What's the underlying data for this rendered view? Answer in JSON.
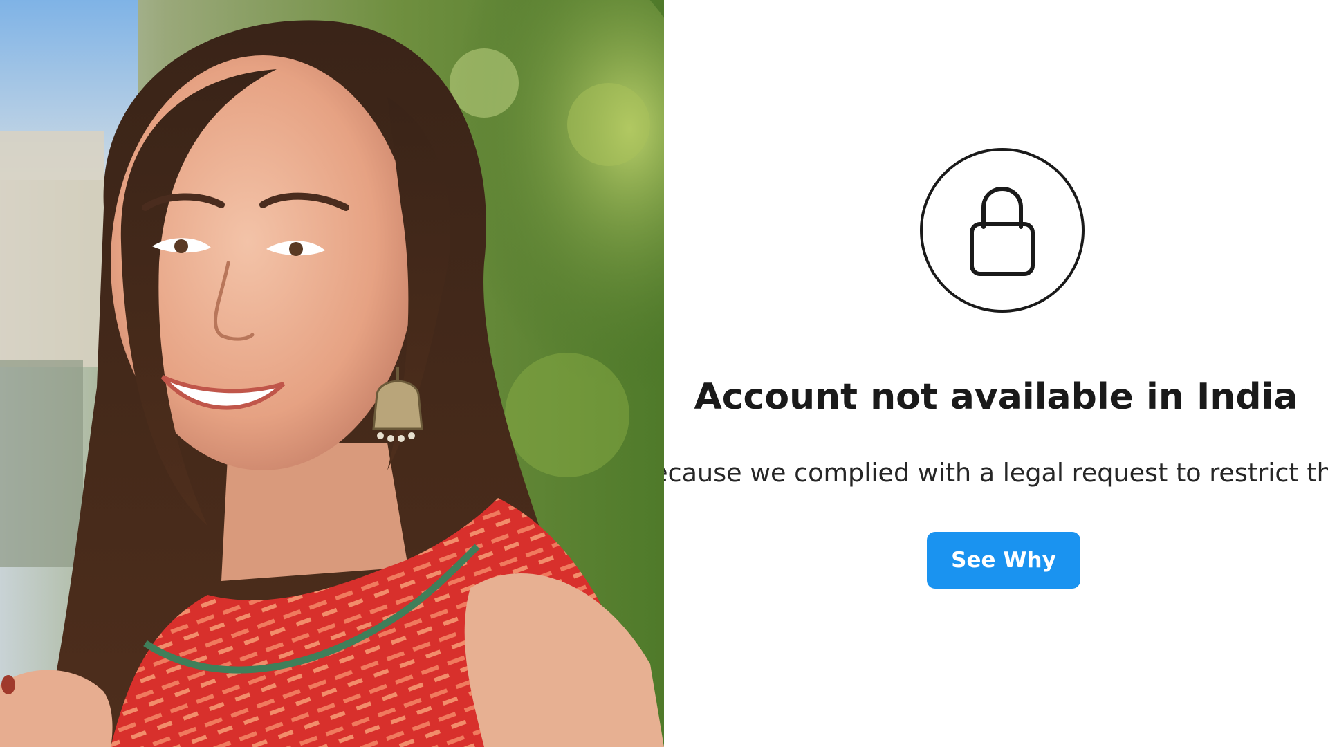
{
  "photo": {
    "description_icon": "portrait-photo"
  },
  "restriction": {
    "icon": "lock-icon",
    "title": "Account not available in India",
    "message": "ecause we complied with a legal request to restrict thi",
    "button_label": "See Why"
  },
  "colors": {
    "button_bg": "#1a93f0",
    "title_text": "#1a1a1a",
    "body_text": "#262626"
  }
}
